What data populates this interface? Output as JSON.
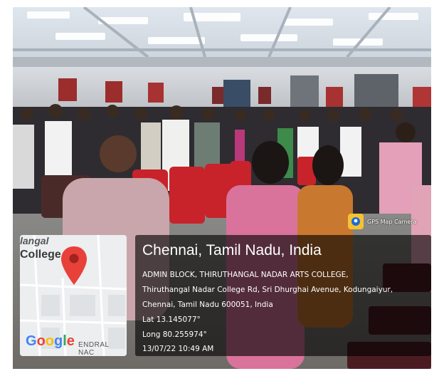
{
  "gps_badge": {
    "label": "GPS Map Camera",
    "icon": "gps-map-camera-app-icon"
  },
  "map": {
    "label_top": "langal",
    "label_college": "College",
    "label_road": "ENDRAL NAC",
    "brand": "Google",
    "pin_icon": "location-pin-icon",
    "pin_color": "#e8413a"
  },
  "location": {
    "city": "Chennai, Tamil Nadu, India",
    "address_line1": "ADMIN BLOCK, THIRUTHANGAL NADAR ARTS COLLEGE,",
    "address_line2": "Thiruthangal Nadar College Rd, Sri Dhurghai Avenue, Kodungaiyur,",
    "address_line3": "Chennai, Tamil Nadu 600051, India",
    "lat": "Lat 13.145077°",
    "long": "Long 80.255974°",
    "datetime": "13/07/22 10:49 AM"
  }
}
